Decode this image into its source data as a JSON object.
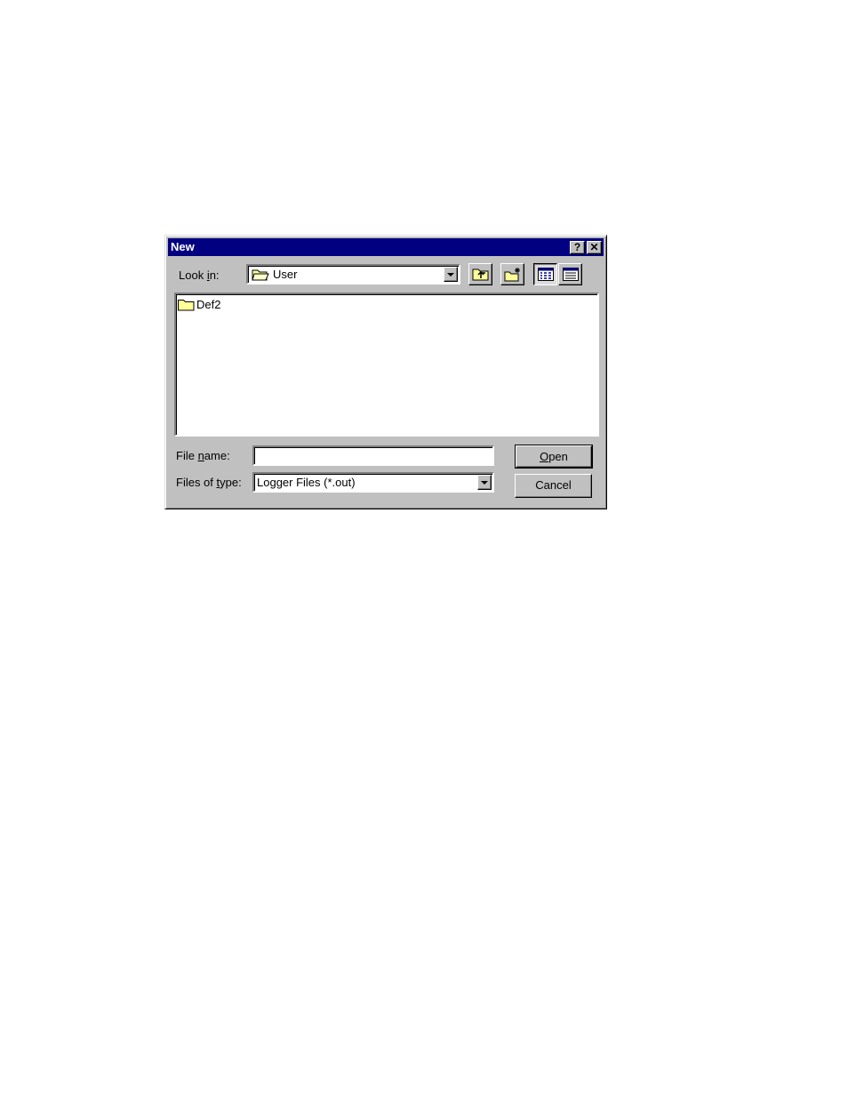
{
  "dialog": {
    "title": "New",
    "help_glyph": "?",
    "close_glyph": "✕"
  },
  "look_in": {
    "label_pre": "Look ",
    "label_accel": "i",
    "label_post": "n:",
    "value": "User",
    "icon": "open-folder-icon"
  },
  "toolbar": {
    "buttons": [
      "up-one-level-icon",
      "create-new-folder-icon",
      "list-view-icon",
      "details-view-icon"
    ]
  },
  "files": [
    {
      "name": "Def2",
      "icon": "folder-icon"
    }
  ],
  "file_name": {
    "label_pre": "File ",
    "label_accel": "n",
    "label_post": "ame:",
    "value": "",
    "placeholder": ""
  },
  "file_type": {
    "label_pre": "Files of ",
    "label_accel": "t",
    "label_post": "ype:",
    "value": "Logger Files (*.out)"
  },
  "buttons": {
    "open_accel": "O",
    "open_rest": "pen",
    "cancel": "Cancel"
  },
  "colors": {
    "titlebar": "#000080",
    "face": "#c0c0c0",
    "folder": "#ffff99"
  }
}
